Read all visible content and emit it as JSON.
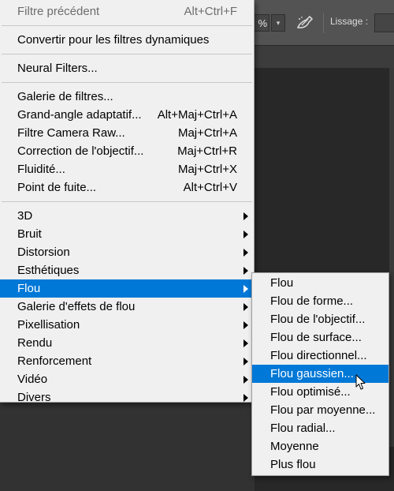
{
  "background": {
    "zoom_value": "%",
    "smoothing_label": "Lissage :",
    "dropdown_glyph": "▾"
  },
  "main_menu": {
    "items": [
      {
        "label": "Filtre précédent",
        "shortcut": "Alt+Ctrl+F",
        "disabled": true
      },
      {
        "label": "Convertir pour les filtres dynamiques",
        "shortcut": ""
      },
      {
        "label": "Neural Filters...",
        "shortcut": ""
      },
      {
        "label": "Galerie de filtres...",
        "shortcut": ""
      },
      {
        "label": "Grand-angle adaptatif...",
        "shortcut": "Alt+Maj+Ctrl+A"
      },
      {
        "label": "Filtre Camera Raw...",
        "shortcut": "Maj+Ctrl+A"
      },
      {
        "label": "Correction de l'objectif...",
        "shortcut": "Maj+Ctrl+R"
      },
      {
        "label": "Fluidité...",
        "shortcut": "Maj+Ctrl+X"
      },
      {
        "label": "Point de fuite...",
        "shortcut": "Alt+Ctrl+V"
      },
      {
        "label": "3D"
      },
      {
        "label": "Bruit"
      },
      {
        "label": "Distorsion"
      },
      {
        "label": "Esthétiques"
      },
      {
        "label": "Flou",
        "highlighted": true
      },
      {
        "label": "Galerie d'effets de flou"
      },
      {
        "label": "Pixellisation"
      },
      {
        "label": "Rendu"
      },
      {
        "label": "Renforcement"
      },
      {
        "label": "Vidéo"
      },
      {
        "label": "Divers"
      }
    ]
  },
  "blur_submenu": {
    "items": [
      {
        "label": "Flou"
      },
      {
        "label": "Flou de forme..."
      },
      {
        "label": "Flou de l'objectif..."
      },
      {
        "label": "Flou de surface..."
      },
      {
        "label": "Flou directionnel..."
      },
      {
        "label": "Flou gaussien...",
        "highlighted": true
      },
      {
        "label": "Flou optimisé..."
      },
      {
        "label": "Flou par moyenne..."
      },
      {
        "label": "Flou radial..."
      },
      {
        "label": "Moyenne"
      },
      {
        "label": "Plus flou"
      }
    ]
  },
  "colors": {
    "menu_bg": "#f0f0f0",
    "highlight": "#0078d7",
    "disabled_text": "#6d6d6d",
    "app_bg": "#323232"
  }
}
